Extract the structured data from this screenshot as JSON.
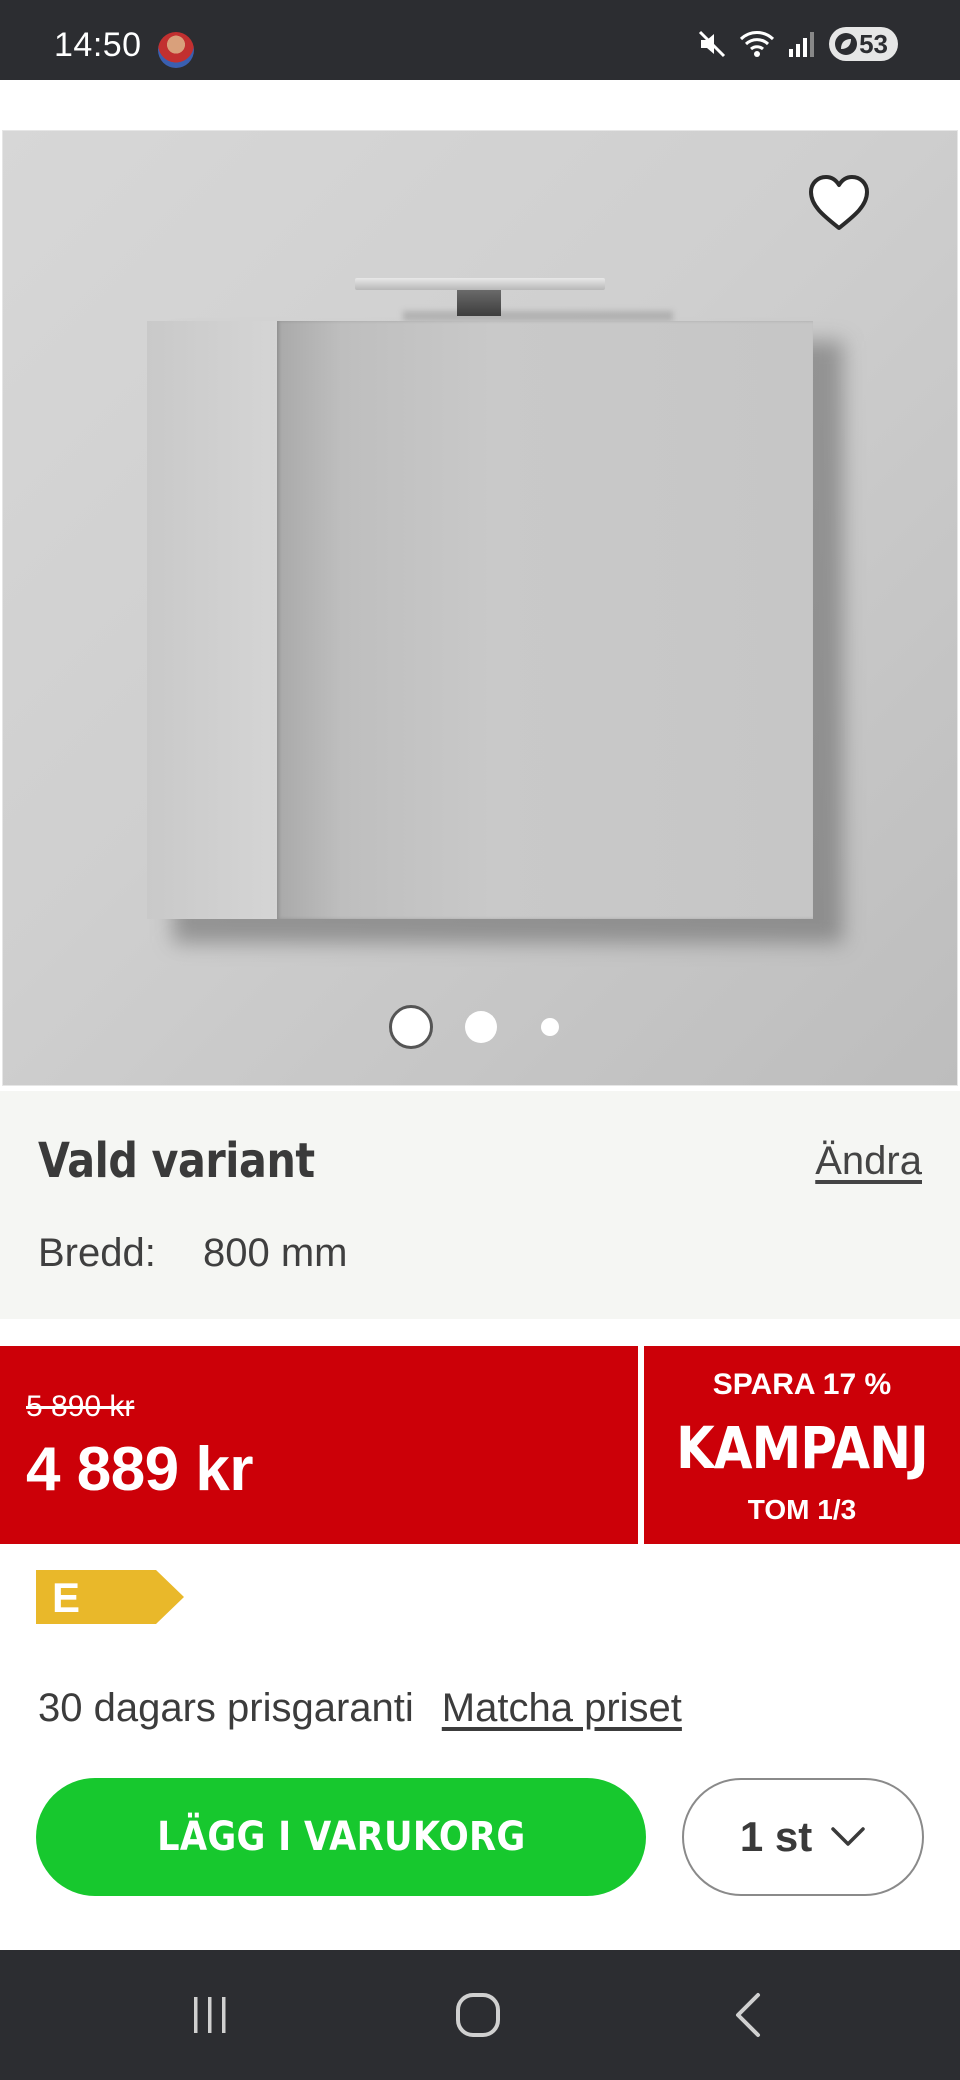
{
  "status_bar": {
    "time": "14:50",
    "battery": "53"
  },
  "product_image": {
    "alt_subject": "mirror cabinet",
    "image_count": 3,
    "active_index": 0
  },
  "variant": {
    "title": "Vald variant",
    "change_label": "Ändra",
    "width_label": "Bredd:",
    "width_value": "800 mm"
  },
  "price": {
    "old_price": "5 890 kr",
    "new_price": "4 889 kr"
  },
  "campaign": {
    "save_text": "SPARA 17 %",
    "label": "KAMPANJ",
    "until_text": "TOM 1/3"
  },
  "energy_label": {
    "class": "E",
    "color": "#e9b82a"
  },
  "price_guarantee": {
    "text": "30 dagars prisgaranti",
    "link_label": "Matcha priset"
  },
  "actions": {
    "add_to_cart_label": "LÄGG I VARUKORG",
    "quantity_label": "1 st"
  },
  "colors": {
    "campaign_red": "#cc0008",
    "cart_green": "#17c82e",
    "system_bar": "#2c2d31"
  }
}
